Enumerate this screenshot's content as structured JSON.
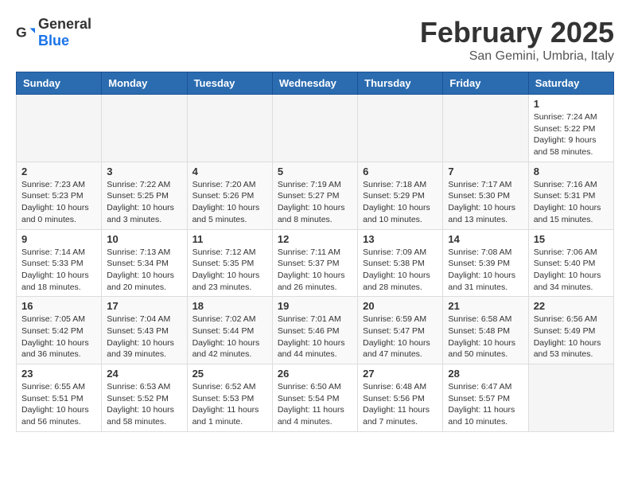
{
  "logo": {
    "general": "General",
    "blue": "Blue"
  },
  "title": "February 2025",
  "subtitle": "San Gemini, Umbria, Italy",
  "weekdays": [
    "Sunday",
    "Monday",
    "Tuesday",
    "Wednesday",
    "Thursday",
    "Friday",
    "Saturday"
  ],
  "weeks": [
    [
      {
        "day": "",
        "info": ""
      },
      {
        "day": "",
        "info": ""
      },
      {
        "day": "",
        "info": ""
      },
      {
        "day": "",
        "info": ""
      },
      {
        "day": "",
        "info": ""
      },
      {
        "day": "",
        "info": ""
      },
      {
        "day": "1",
        "info": "Sunrise: 7:24 AM\nSunset: 5:22 PM\nDaylight: 9 hours and 58 minutes."
      }
    ],
    [
      {
        "day": "2",
        "info": "Sunrise: 7:23 AM\nSunset: 5:23 PM\nDaylight: 10 hours and 0 minutes."
      },
      {
        "day": "3",
        "info": "Sunrise: 7:22 AM\nSunset: 5:25 PM\nDaylight: 10 hours and 3 minutes."
      },
      {
        "day": "4",
        "info": "Sunrise: 7:20 AM\nSunset: 5:26 PM\nDaylight: 10 hours and 5 minutes."
      },
      {
        "day": "5",
        "info": "Sunrise: 7:19 AM\nSunset: 5:27 PM\nDaylight: 10 hours and 8 minutes."
      },
      {
        "day": "6",
        "info": "Sunrise: 7:18 AM\nSunset: 5:29 PM\nDaylight: 10 hours and 10 minutes."
      },
      {
        "day": "7",
        "info": "Sunrise: 7:17 AM\nSunset: 5:30 PM\nDaylight: 10 hours and 13 minutes."
      },
      {
        "day": "8",
        "info": "Sunrise: 7:16 AM\nSunset: 5:31 PM\nDaylight: 10 hours and 15 minutes."
      }
    ],
    [
      {
        "day": "9",
        "info": "Sunrise: 7:14 AM\nSunset: 5:33 PM\nDaylight: 10 hours and 18 minutes."
      },
      {
        "day": "10",
        "info": "Sunrise: 7:13 AM\nSunset: 5:34 PM\nDaylight: 10 hours and 20 minutes."
      },
      {
        "day": "11",
        "info": "Sunrise: 7:12 AM\nSunset: 5:35 PM\nDaylight: 10 hours and 23 minutes."
      },
      {
        "day": "12",
        "info": "Sunrise: 7:11 AM\nSunset: 5:37 PM\nDaylight: 10 hours and 26 minutes."
      },
      {
        "day": "13",
        "info": "Sunrise: 7:09 AM\nSunset: 5:38 PM\nDaylight: 10 hours and 28 minutes."
      },
      {
        "day": "14",
        "info": "Sunrise: 7:08 AM\nSunset: 5:39 PM\nDaylight: 10 hours and 31 minutes."
      },
      {
        "day": "15",
        "info": "Sunrise: 7:06 AM\nSunset: 5:40 PM\nDaylight: 10 hours and 34 minutes."
      }
    ],
    [
      {
        "day": "16",
        "info": "Sunrise: 7:05 AM\nSunset: 5:42 PM\nDaylight: 10 hours and 36 minutes."
      },
      {
        "day": "17",
        "info": "Sunrise: 7:04 AM\nSunset: 5:43 PM\nDaylight: 10 hours and 39 minutes."
      },
      {
        "day": "18",
        "info": "Sunrise: 7:02 AM\nSunset: 5:44 PM\nDaylight: 10 hours and 42 minutes."
      },
      {
        "day": "19",
        "info": "Sunrise: 7:01 AM\nSunset: 5:46 PM\nDaylight: 10 hours and 44 minutes."
      },
      {
        "day": "20",
        "info": "Sunrise: 6:59 AM\nSunset: 5:47 PM\nDaylight: 10 hours and 47 minutes."
      },
      {
        "day": "21",
        "info": "Sunrise: 6:58 AM\nSunset: 5:48 PM\nDaylight: 10 hours and 50 minutes."
      },
      {
        "day": "22",
        "info": "Sunrise: 6:56 AM\nSunset: 5:49 PM\nDaylight: 10 hours and 53 minutes."
      }
    ],
    [
      {
        "day": "23",
        "info": "Sunrise: 6:55 AM\nSunset: 5:51 PM\nDaylight: 10 hours and 56 minutes."
      },
      {
        "day": "24",
        "info": "Sunrise: 6:53 AM\nSunset: 5:52 PM\nDaylight: 10 hours and 58 minutes."
      },
      {
        "day": "25",
        "info": "Sunrise: 6:52 AM\nSunset: 5:53 PM\nDaylight: 11 hours and 1 minute."
      },
      {
        "day": "26",
        "info": "Sunrise: 6:50 AM\nSunset: 5:54 PM\nDaylight: 11 hours and 4 minutes."
      },
      {
        "day": "27",
        "info": "Sunrise: 6:48 AM\nSunset: 5:56 PM\nDaylight: 11 hours and 7 minutes."
      },
      {
        "day": "28",
        "info": "Sunrise: 6:47 AM\nSunset: 5:57 PM\nDaylight: 11 hours and 10 minutes."
      },
      {
        "day": "",
        "info": ""
      }
    ]
  ]
}
